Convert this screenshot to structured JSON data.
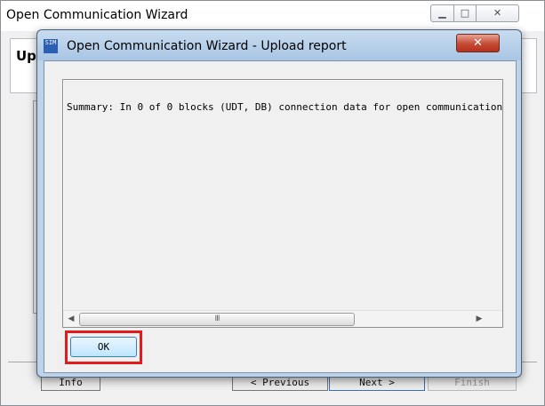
{
  "outer_window": {
    "title": "Open Communication Wizard",
    "header_text": "Up",
    "buttons": {
      "info": "Info",
      "previous": "< Previous",
      "next": "Next >",
      "finish": "Finish"
    }
  },
  "dialog": {
    "title": "Open Communication Wizard - Upload report",
    "icon_text": "SIM",
    "close_glyph": "✕",
    "report_text": "Summary: In 0 of 0 blocks (UDT, DB) connection data for open communication",
    "scroll_grip": "III",
    "ok_label": "OK"
  },
  "colors": {
    "highlight": "#e31b1b",
    "dialog_frame": "#bcd3ea",
    "close_button": "#c44a35"
  }
}
